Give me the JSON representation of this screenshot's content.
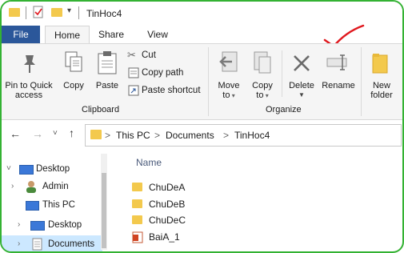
{
  "window": {
    "title": "TinHoc4"
  },
  "tabs": [
    {
      "label": "File"
    },
    {
      "label": "Home"
    },
    {
      "label": "Share"
    },
    {
      "label": "View"
    }
  ],
  "ribbon": {
    "clipboard": {
      "group_label": "Clipboard",
      "pin_label_1": "Pin to Quick",
      "pin_label_2": "access",
      "copy_label": "Copy",
      "paste_label": "Paste",
      "cut_label": "Cut",
      "copy_path_label": "Copy path",
      "paste_shortcut_label": "Paste shortcut"
    },
    "organize": {
      "group_label": "Organize",
      "move_label_1": "Move",
      "move_label_2": "to",
      "copy_label_1": "Copy",
      "copy_label_2": "to",
      "delete_label": "Delete",
      "rename_label": "Rename"
    },
    "new": {
      "new_folder_label_1": "New",
      "new_folder_label_2": "folder"
    }
  },
  "address": {
    "crumbs": [
      "This PC",
      "Documents",
      "TinHoc4"
    ],
    "separator": ">"
  },
  "nav": {
    "items": [
      {
        "label": "Desktop"
      },
      {
        "label": "Admin"
      },
      {
        "label": "This PC"
      },
      {
        "label": "Desktop"
      },
      {
        "label": "Documents"
      }
    ]
  },
  "content": {
    "column_name": "Name",
    "files": [
      {
        "name": "ChuDeA",
        "icon": "folder-icon"
      },
      {
        "name": "ChuDeB",
        "icon": "folder-icon"
      },
      {
        "name": "ChuDeC",
        "icon": "folder-icon"
      },
      {
        "name": "BaiA_1",
        "icon": "powerpoint-icon"
      }
    ]
  },
  "colors": {
    "file_tab": "#2b579a",
    "border": "#34b233",
    "annotation": "#e0181e",
    "folder": "#f3c94d",
    "selection": "#cce8ff"
  }
}
